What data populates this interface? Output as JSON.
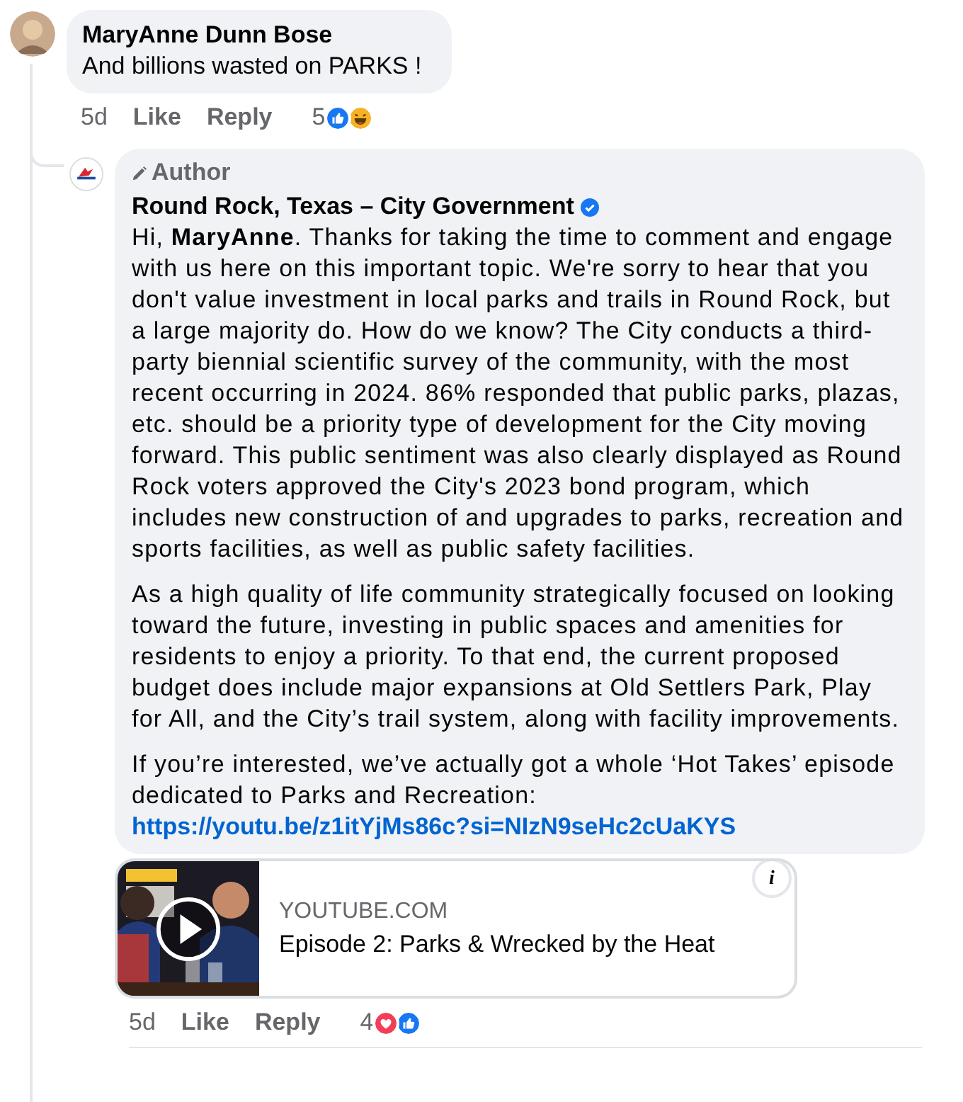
{
  "comment": {
    "author": "MaryAnne Dunn Bose",
    "text": "And billions wasted on PARKS !",
    "time": "5d",
    "actions": [
      "Like",
      "Reply"
    ],
    "reaction_count": "5",
    "reactions": [
      {
        "kind": "like"
      },
      {
        "kind": "haha"
      }
    ]
  },
  "reply": {
    "badge": "Author",
    "author": "Round Rock, Texas – City Government",
    "verified": true,
    "paragraphs": [
      "Hi, **MaryAnne**. Thanks for taking the time to comment and engage with us here on this important topic. We're sorry to hear that you don't value investment in local parks and trails in Round Rock, but a large majority do. How do we know? The City conducts a third-party biennial scientific survey of the community, with the most recent occurring in 2024. 86% responded that public parks, plazas, etc. should be a priority type of development for the City moving forward. This public sentiment was also clearly displayed as Round Rock voters approved the City's 2023 bond program, which includes new construction of and upgrades to parks, recreation and sports facilities, as well as public safety facilities.",
      "As a high quality of life community strategically focused on looking toward the future, investing in public spaces and amenities for residents to enjoy a priority. To that end, the current proposed budget does include major expansions at Old Settlers Park, Play for All, and the City’s trail system, along with facility improvements.",
      "If you’re interested, we’ve actually got a whole ‘Hot Takes’ episode dedicated to Parks and Recreation:"
    ],
    "link": "https://youtu.be/z1itYjMs86c?si=NIzN9seHc2cUaKYS",
    "preview": {
      "kind": "picture",
      "domain": "YOUTUBE.COM",
      "title": "Episode 2: Parks & Wrecked by the Heat",
      "info": "i"
    },
    "time": "5d",
    "actions": [
      "Like",
      "Reply"
    ],
    "reaction_count": "4",
    "reactions": [
      {
        "kind": "love"
      },
      {
        "kind": "like"
      }
    ]
  }
}
